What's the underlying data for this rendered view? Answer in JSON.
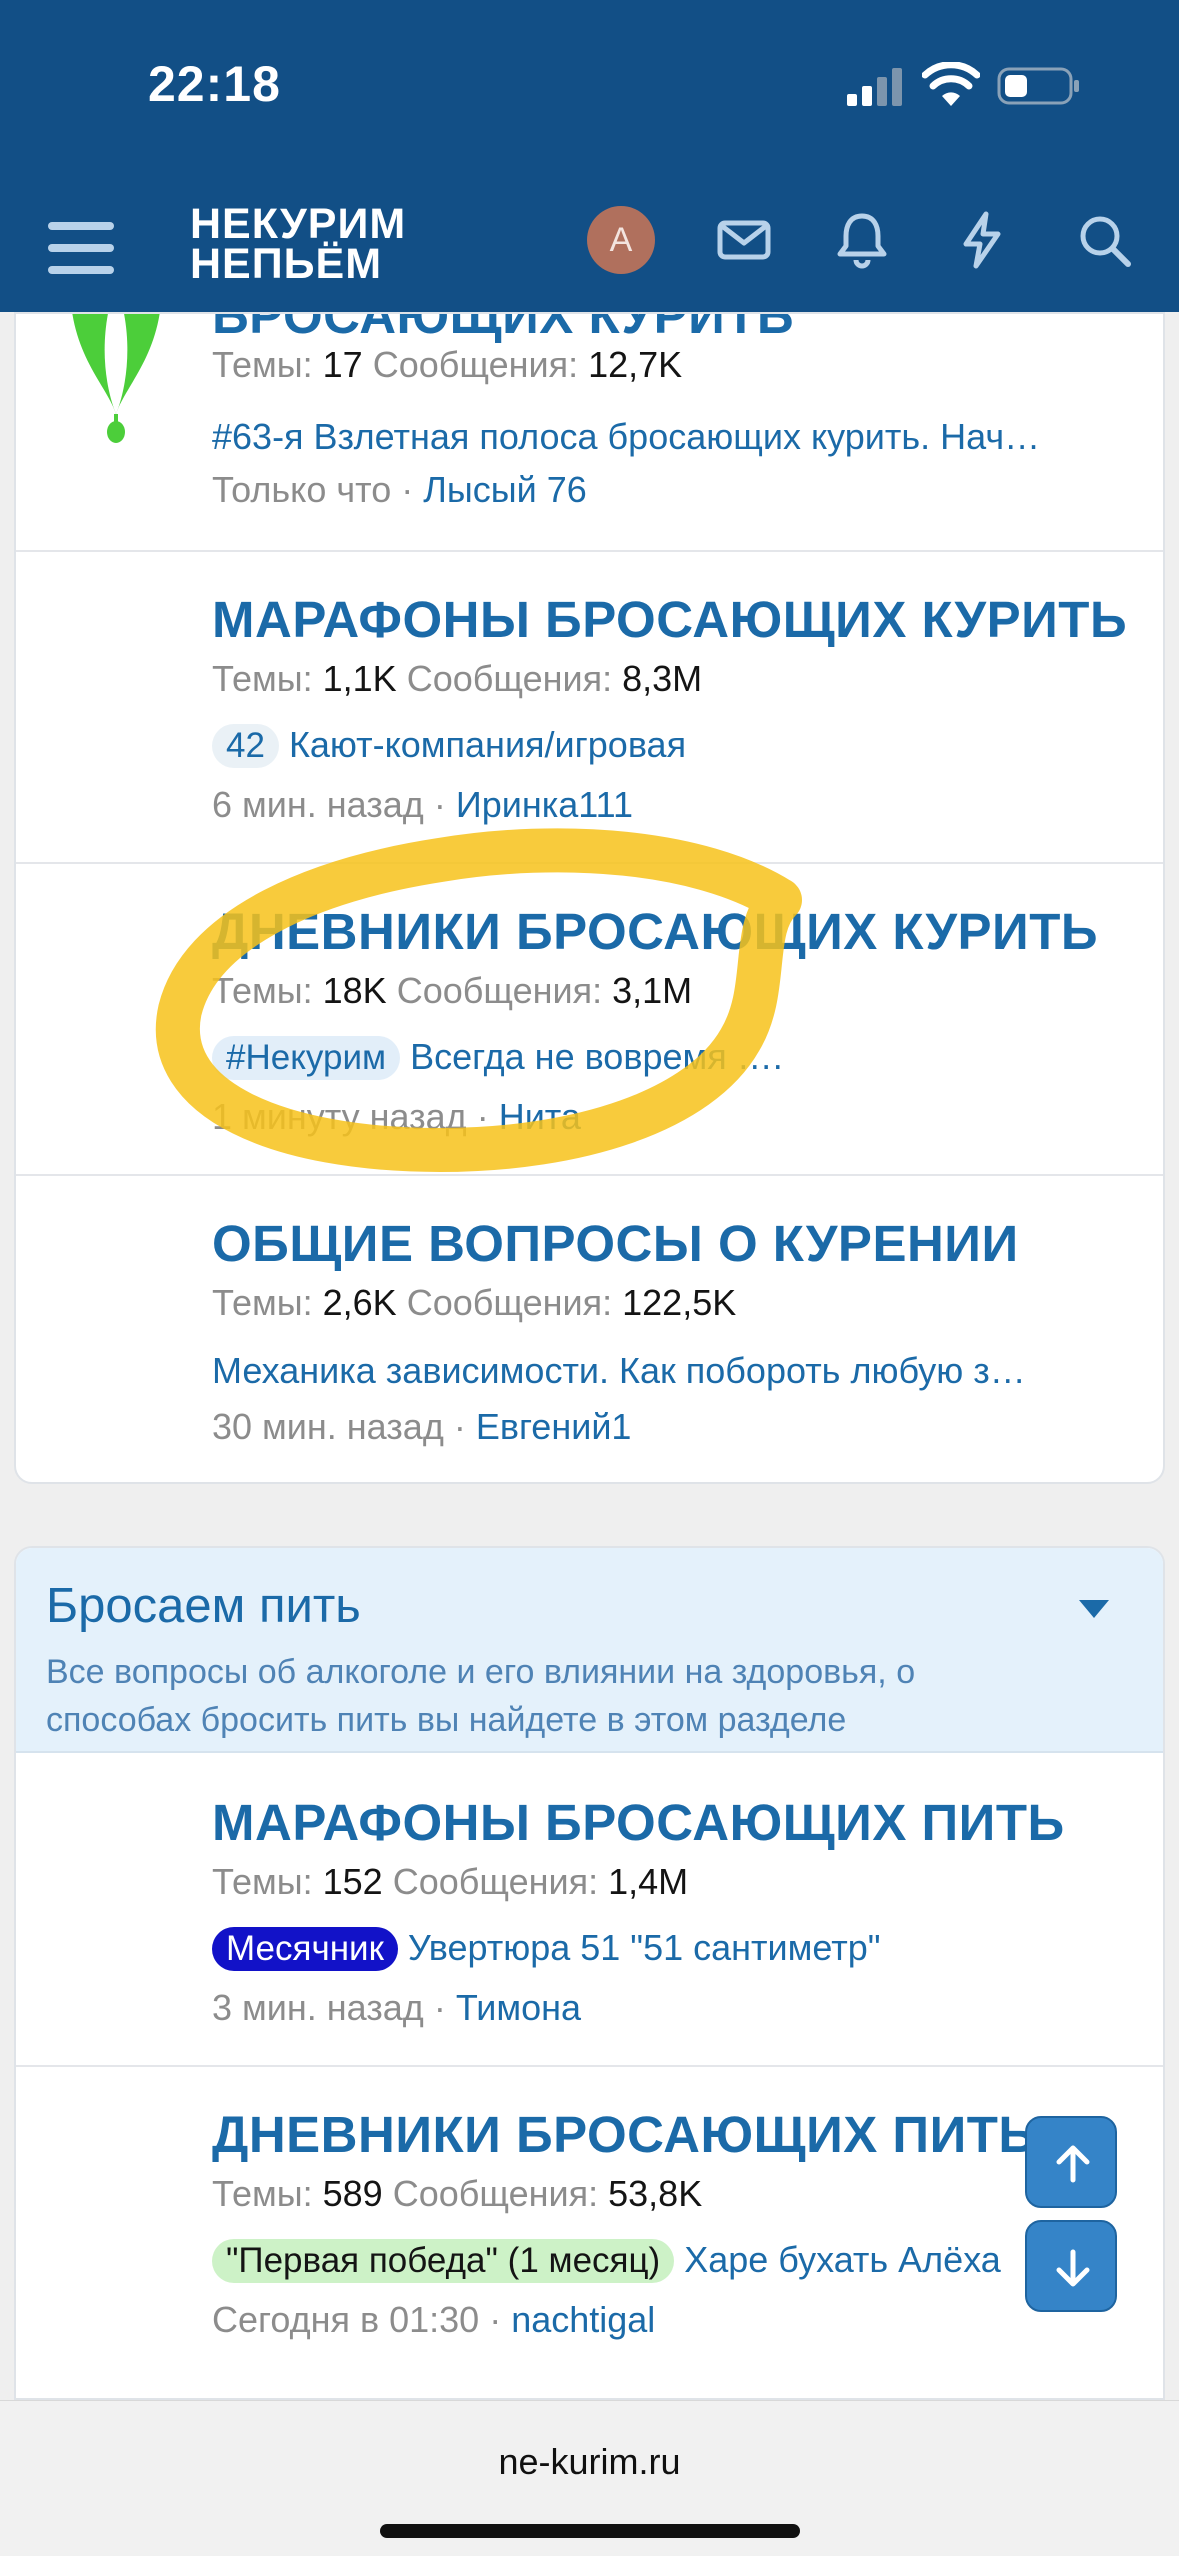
{
  "status_bar": {
    "time": "22:18"
  },
  "header": {
    "logo_line1": "НЕКУРИМ",
    "logo_line2": "НЕПЬЁМ",
    "avatar_letter": "A",
    "accent_color": "#124f86"
  },
  "partial_node": {
    "title_fragment": "БРОСАЮЩИХ КУРИТЬ",
    "stats": {
      "themes_label": "Темы:",
      "themes": "17",
      "messages_label": "Сообщения:",
      "messages": "12,7K"
    },
    "last_post": "#63-я Взлетная полоса бросающих курить. Нач…",
    "time": "Только что",
    "separator": " · ",
    "user": "Лысый 76"
  },
  "smoking_nodes": [
    {
      "title": "МАРАФОНЫ БРОСАЮЩИХ КУРИТЬ",
      "themes_label": "Темы:",
      "themes": "1,1K",
      "messages_label": "Сообщения:",
      "messages": "8,3M",
      "prefix": "42",
      "last_post": "Кают-компания/игровая",
      "time": "6 мин. назад",
      "separator": " · ",
      "user": "Иринка111"
    },
    {
      "title": "ДНЕВНИКИ БРОСАЮЩИХ КУРИТЬ",
      "themes_label": "Темы:",
      "themes": "18K",
      "messages_label": "Сообщения:",
      "messages": "3,1M",
      "prefix": "#Некурим",
      "last_post": "Всегда не вовремя ….",
      "time": "1 минуту назад",
      "separator": " · ",
      "user": "Нита"
    },
    {
      "title": "ОБЩИЕ ВОПРОСЫ О КУРЕНИИ",
      "themes_label": "Темы:",
      "themes": "2,6K",
      "messages_label": "Сообщения:",
      "messages": "122,5K",
      "last_post": "Механика зависимости. Как побороть любую з…",
      "time": "30 мин. назад",
      "separator": " · ",
      "user": "Евгений1"
    }
  ],
  "drinking_category": {
    "title": "Бросаем пить",
    "description": "Все вопросы об алкоголе и его влиянии на здоровья, о способах бросить пить вы найдете в этом разделе"
  },
  "drinking_nodes": [
    {
      "title": "МАРАФОНЫ БРОСАЮЩИХ ПИТЬ",
      "themes_label": "Темы:",
      "themes": "152",
      "messages_label": "Сообщения:",
      "messages": "1,4M",
      "prefix": "Месячник",
      "last_post": "Увертюра 51 \"51 сантиметр\"",
      "time": "3 мин. назад",
      "separator": " · ",
      "user": "Тимона"
    },
    {
      "title": "ДНЕВНИКИ БРОСАЮЩИХ ПИТЬ",
      "themes_label": "Темы:",
      "themes": "589",
      "messages_label": "Сообщения:",
      "messages": "53,8K",
      "prefix": "\"Первая победа\" (1 месяц)",
      "last_post": "Харе бухать Алёха",
      "time": "Сегодня в 01:30",
      "separator": " · ",
      "user": "nachtigal"
    }
  ],
  "browser": {
    "url": "ne-kurim.ru"
  },
  "highlight_color": "#f7c21a"
}
